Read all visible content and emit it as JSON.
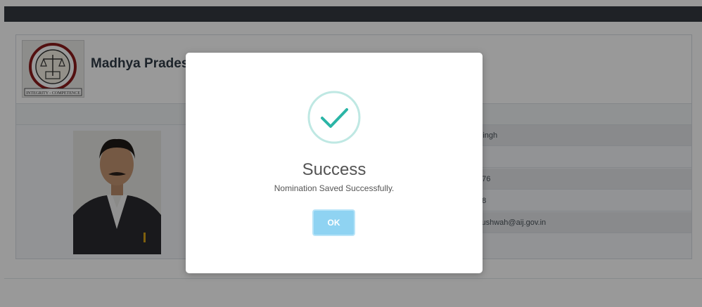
{
  "header": {
    "org_title": "Madhya Pradesh"
  },
  "emblem": {
    "banner_text": "INTEGRITY - COMPETENCE"
  },
  "details": {
    "rows": [
      {
        "value": "Singh",
        "shaded": true
      },
      {
        "value": "",
        "shaded": false
      },
      {
        "value": "976",
        "shaded": true
      },
      {
        "value": "98",
        "shaded": false
      },
      {
        "value": "cushwah@aij.gov.in",
        "shaded": true
      }
    ]
  },
  "modal": {
    "title": "Success",
    "message": "Nomination Saved Successfully.",
    "ok_label": "OK",
    "icon": "check-circle-icon"
  },
  "colors": {
    "navbar": "#343a40",
    "success_accent": "#2bb5a6",
    "ok_button": "#8fd3f2",
    "overlay": "rgba(0,0,0,0.40)"
  }
}
